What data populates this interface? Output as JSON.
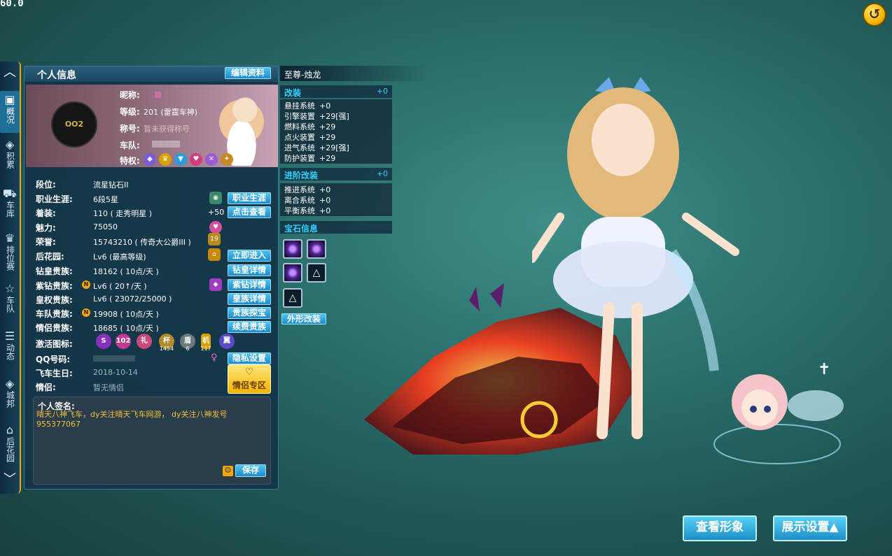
{
  "fps": "60.0",
  "nav": {
    "items": [
      {
        "label": "概况",
        "icon": "profile-card-icon"
      },
      {
        "label": "积累",
        "icon": "layers-icon"
      },
      {
        "label": "车库",
        "icon": "car-icon"
      },
      {
        "label": "排位赛",
        "icon": "rank-icon"
      },
      {
        "label": "车队",
        "icon": "star-icon"
      },
      {
        "label": "动态",
        "icon": "feed-icon"
      },
      {
        "label": "城邦",
        "icon": "layers-icon"
      },
      {
        "label": "后花园",
        "icon": "garden-icon"
      }
    ]
  },
  "panel": {
    "title": "个人信息",
    "edit_label": "编辑资料",
    "avatar_text": "OO2",
    "nickname_label": "昵称:",
    "level_label": "等级:",
    "level_value": "201 (雷霆车神)",
    "title_label": "称号:",
    "title_value": "暂未获得称号",
    "team_label": "车队:",
    "privilege_label": "特权:"
  },
  "rows": {
    "rank": {
      "label": "段位:",
      "value": "流星钻石II"
    },
    "career": {
      "label": "职业生涯:",
      "value": "6段5星",
      "button": "职业生涯"
    },
    "outfit": {
      "label": "着装:",
      "value": "110 ( 走秀明星 )",
      "bonus": "+50",
      "button": "点击查看"
    },
    "charm": {
      "label": "魅力:",
      "value": "75050"
    },
    "honor": {
      "label": "荣誉:",
      "value": "15743210 ( 传奇大公爵III )",
      "badge": "19"
    },
    "garden": {
      "label": "后花园:",
      "value": "Lv6 (最高等级)",
      "button": "立即进入"
    },
    "diamond": {
      "label": "钻皇贵族:",
      "value": "18162 ( 10点/天 )",
      "button": "钻皇详情"
    },
    "purple": {
      "label": "紫钻贵族:",
      "value": "Lv6 ( 20↑/天 )",
      "button": "紫钻详情"
    },
    "royal": {
      "label": "皇权贵族:",
      "value": "Lv6 ( 23072/25000 )",
      "button": "皇族详情"
    },
    "team_noble": {
      "label": "车队贵族:",
      "value": "19908 ( 10点/天 )",
      "button": "贵族探宝"
    },
    "couple_noble": {
      "label": "情侣贵族:",
      "value": "18685 ( 10点/天 )",
      "button": "续费贵族"
    },
    "icons": {
      "label": "激活图标:"
    },
    "qq": {
      "label": "QQ号码:",
      "button": "隐私设置"
    },
    "birthday": {
      "label": "飞车生日:",
      "value": "2018-10-14"
    },
    "partner": {
      "label": "情侣:",
      "value": "暂无情侣"
    }
  },
  "badges": [
    {
      "icon": "s-badge-icon",
      "text": "S",
      "color": "#8a2fc0"
    },
    {
      "icon": "vip-badge-icon",
      "text": "102",
      "color": "#c23a8d"
    },
    {
      "icon": "gift-icon",
      "text": "礼",
      "color": "#c9497a"
    },
    {
      "icon": "trophy-icon",
      "text": "杯",
      "color": "#b58a2a",
      "caption": "1454"
    },
    {
      "icon": "shield-icon",
      "text": "盾",
      "color": "#6d7a7a",
      "caption": "6"
    },
    {
      "icon": "phone-icon",
      "text": "机",
      "color": "#d9a000",
      "caption": "117"
    },
    {
      "icon": "wings-icon",
      "text": "翼",
      "color": "#5a4cc8"
    }
  ],
  "couple_zone": "情侣专区",
  "signature": {
    "title": "个人签名:",
    "text": "晴天八神飞车，dy关注晴天飞车网游， dy关注八神发号955377067",
    "save": "保存"
  },
  "info": {
    "car_name": "至尊-烛龙",
    "mod_title": "改装",
    "mod_total": "+0",
    "mods": [
      {
        "name": "悬挂系统",
        "value": "+0"
      },
      {
        "name": "引擎装置",
        "value": "+29[强]"
      },
      {
        "name": "燃料系统",
        "value": "+29"
      },
      {
        "name": "点火装置",
        "value": "+29"
      },
      {
        "name": "进气系统",
        "value": "+29[强]"
      },
      {
        "name": "防护装置",
        "value": "+29"
      }
    ],
    "adv_title": "进阶改装",
    "adv_total": "+0",
    "adv": [
      {
        "name": "推进系统",
        "value": "+0"
      },
      {
        "name": "离合系统",
        "value": "+0"
      },
      {
        "name": "平衡系统",
        "value": "+0"
      }
    ],
    "gem_title": "宝石信息",
    "exterior": "外形改装"
  },
  "buttons": {
    "view_look": "查看形象",
    "display_settings": "展示设置▲"
  }
}
